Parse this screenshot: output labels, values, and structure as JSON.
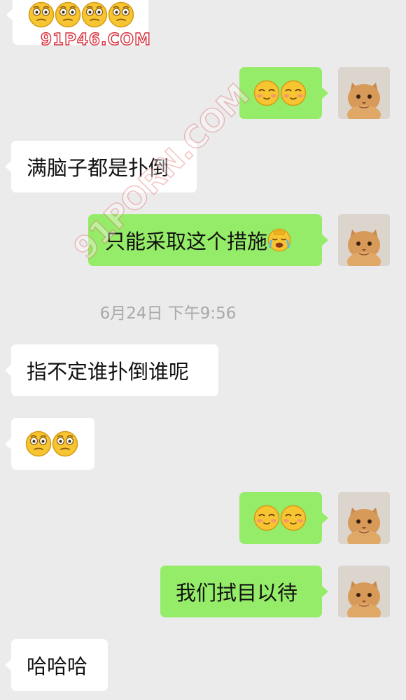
{
  "messages": [
    {
      "id": "m1",
      "side": "in",
      "emojis": [
        "grimace",
        "grimace",
        "grimace",
        "grimace"
      ]
    },
    {
      "id": "m2",
      "side": "out",
      "emojis": [
        "blush",
        "blush"
      ]
    },
    {
      "id": "m3",
      "side": "in",
      "text": "满脑子都是扑倒"
    },
    {
      "id": "m4",
      "side": "out",
      "text": "只能采取这个措施",
      "emojis": [
        "facepalm"
      ]
    },
    {
      "id": "m5",
      "side": "in",
      "text": "指不定谁扑倒谁呢"
    },
    {
      "id": "m6",
      "side": "in",
      "emojis": [
        "grimace",
        "grimace"
      ]
    },
    {
      "id": "m7",
      "side": "out",
      "emojis": [
        "blush",
        "blush"
      ]
    },
    {
      "id": "m8",
      "side": "out",
      "text": "我们拭目以待"
    },
    {
      "id": "m9",
      "side": "in",
      "text": "哈哈哈"
    }
  ],
  "timestamp": "6月24日 下午9:56",
  "watermark": {
    "top": "91P46.COM",
    "diagonal": "91PORN.COM"
  },
  "colors": {
    "background": "#ebebeb",
    "incoming": "#ffffff",
    "outgoing": "#95ec69",
    "timestamp": "#a9a9a9",
    "watermark": "#d8303c"
  }
}
